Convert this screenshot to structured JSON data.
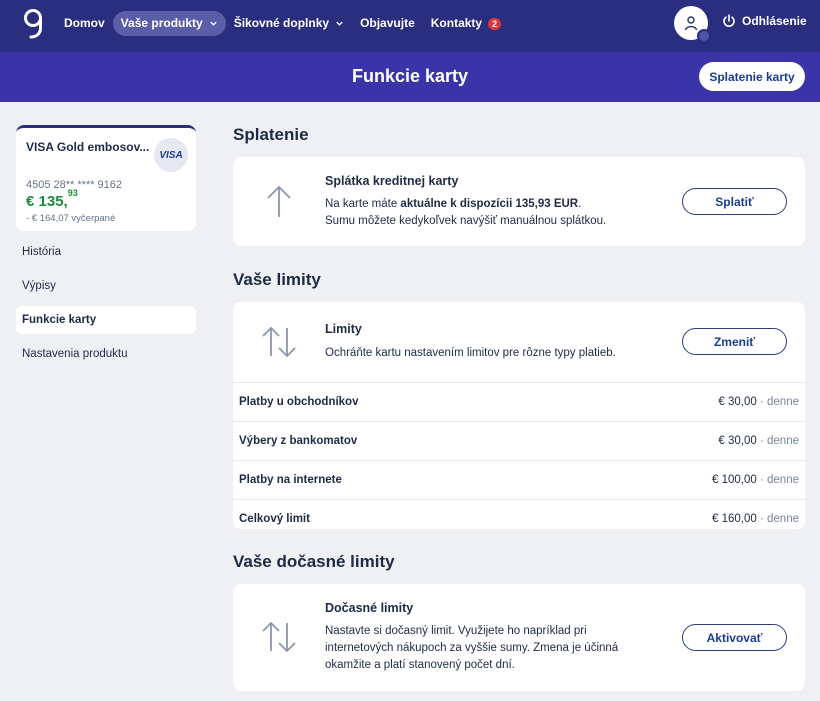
{
  "nav": {
    "items": [
      {
        "label": "Domov"
      },
      {
        "label": "Vaše produkty"
      },
      {
        "label": "Šikovné doplnky"
      },
      {
        "label": "Objavujte"
      },
      {
        "label": "Kontakty"
      }
    ],
    "contacts_badge": "2",
    "logout_label": "Odhlásenie"
  },
  "header": {
    "title": "Funkcie karty",
    "pay_button": "Splatenie karty"
  },
  "card": {
    "name": "VISA Gold embosov...",
    "brand": "VISA",
    "number": "4505 28** **** 9162",
    "balance_main": "€ 135,",
    "balance_cents": "93",
    "used": "- € 164,07 vyčerpané"
  },
  "sidebar": {
    "items": [
      {
        "label": "História"
      },
      {
        "label": "Výpisy"
      },
      {
        "label": "Funkcie karty"
      },
      {
        "label": "Nastavenia produktu"
      }
    ]
  },
  "repayment": {
    "section_title": "Splatenie",
    "heading": "Splátka kreditnej karty",
    "text_prefix": "Na karte máte ",
    "text_bold": "aktuálne k dispozícii 135,93 EUR",
    "text_suffix": ".",
    "text_line2": "Sumu môžete kedykoľvek navýšiť manuálnou splátkou.",
    "button": "Splatiť"
  },
  "limits": {
    "section_title": "Vaše limity",
    "heading": "Limity",
    "text": "Ochráňte kartu nastavením limitov pre rôzne typy platieb.",
    "button": "Zmeniť",
    "rows": [
      {
        "label": "Platby u obchodníkov",
        "value": "€ 30,00",
        "period": "· denne"
      },
      {
        "label": "Výbery z bankomatov",
        "value": "€ 30,00",
        "period": "· denne"
      },
      {
        "label": "Platby na internete",
        "value": "€ 100,00",
        "period": "· denne"
      },
      {
        "label": "Celkový limit",
        "value": "€ 160,00",
        "period": "· denne"
      }
    ]
  },
  "temp_limits": {
    "section_title": "Vaše dočasné limity",
    "heading": "Dočasné limity",
    "text_line1": "Nastavte si dočasný limit. Využijete ho napríklad pri",
    "text_line2": "internetových nákupoch za vyššie sumy. Zmena je účinná",
    "text_line3": "okamžite a platí stanovený počet dní.",
    "button": "Aktivovať"
  }
}
